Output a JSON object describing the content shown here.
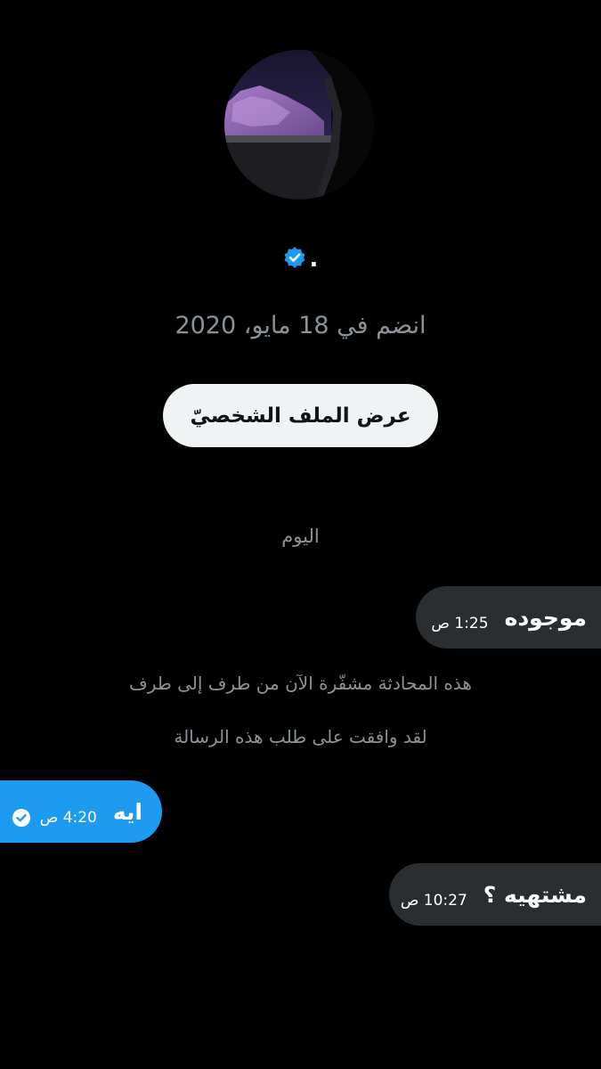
{
  "profile": {
    "avatar_icon": "profile-photo-mountain-car-window",
    "display_name": ".",
    "verified_icon": "verified-badge-icon",
    "verified_color": "#1d9bf0",
    "joined_text": "انضم في 18 مايو، 2020",
    "view_profile_label": "عرض الملف الشخصيّ"
  },
  "conversation": {
    "date_separator": "اليوم",
    "messages": [
      {
        "direction": "incoming",
        "text": "موجوده",
        "time": "1:25 ص"
      },
      {
        "direction": "outgoing",
        "text": "ايه",
        "time": "4:20 ص",
        "status_icon": "read-check-icon"
      },
      {
        "direction": "incoming",
        "text": "مشتهيه ؟",
        "time": "10:27 ص"
      }
    ],
    "system_notes": [
      "هذه المحادثة مشفّرة الآن من طرف إلى طرف",
      "لقد وافقت على طلب هذه الرسالة"
    ]
  },
  "colors": {
    "background": "#000000",
    "incoming_bubble": "#2b2e31",
    "outgoing_bubble": "#1d9bf0",
    "muted_text": "#8b9298",
    "button_bg": "#eff3f4"
  }
}
